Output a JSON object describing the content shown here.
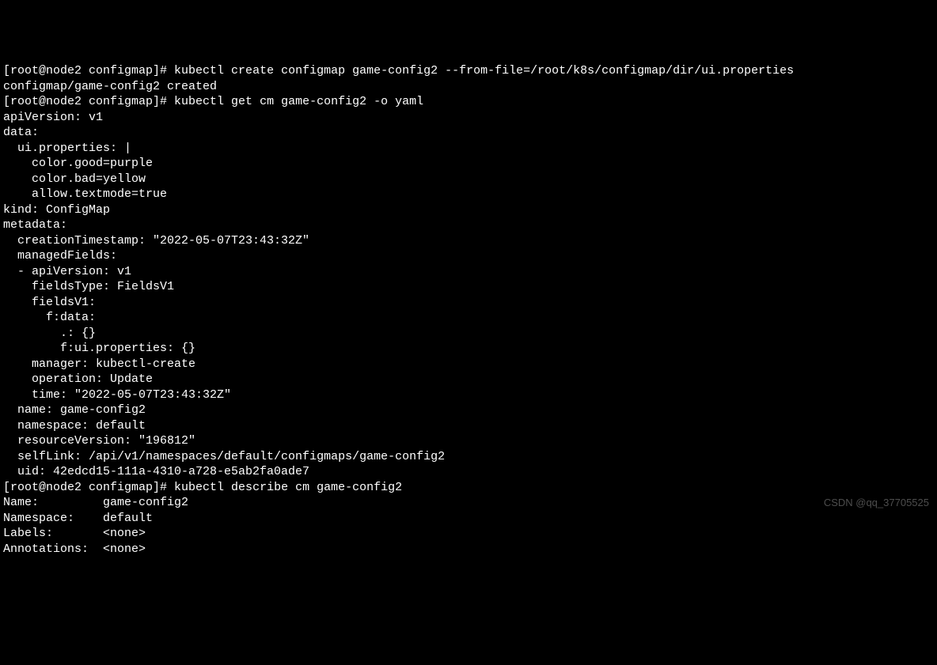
{
  "terminal": {
    "prompt1": "[root@node2 configmap]# ",
    "cmd1": "kubectl create configmap game-config2 --from-file=/root/k8s/configmap/dir/ui.properties",
    "out1": "configmap/game-config2 created",
    "prompt2": "[root@node2 configmap]# ",
    "cmd2": "kubectl get cm game-config2 -o yaml",
    "yaml_line1": "apiVersion: v1",
    "yaml_line2": "data:",
    "yaml_line3": "  ui.properties: |",
    "yaml_line4": "    color.good=purple",
    "yaml_line5": "    color.bad=yellow",
    "yaml_line6": "    allow.textmode=true",
    "yaml_line7": "kind: ConfigMap",
    "yaml_line8": "metadata:",
    "yaml_line9": "  creationTimestamp: \"2022-05-07T23:43:32Z\"",
    "yaml_line10": "  managedFields:",
    "yaml_line11": "  - apiVersion: v1",
    "yaml_line12": "    fieldsType: FieldsV1",
    "yaml_line13": "    fieldsV1:",
    "yaml_line14": "      f:data:",
    "yaml_line15": "        .: {}",
    "yaml_line16": "        f:ui.properties: {}",
    "yaml_line17": "    manager: kubectl-create",
    "yaml_line18": "    operation: Update",
    "yaml_line19": "    time: \"2022-05-07T23:43:32Z\"",
    "yaml_line20": "  name: game-config2",
    "yaml_line21": "  namespace: default",
    "yaml_line22": "  resourceVersion: \"196812\"",
    "yaml_line23": "  selfLink: /api/v1/namespaces/default/configmaps/game-config2",
    "yaml_line24": "  uid: 42edcd15-111a-4310-a728-e5ab2fa0ade7",
    "prompt3": "[root@node2 configmap]# ",
    "cmd3": "kubectl describe cm game-config2",
    "desc_line1": "Name:         game-config2",
    "desc_line2": "Namespace:    default",
    "desc_line3": "Labels:       <none>",
    "desc_line4": "Annotations:  <none>"
  },
  "watermark": "CSDN @qq_37705525"
}
